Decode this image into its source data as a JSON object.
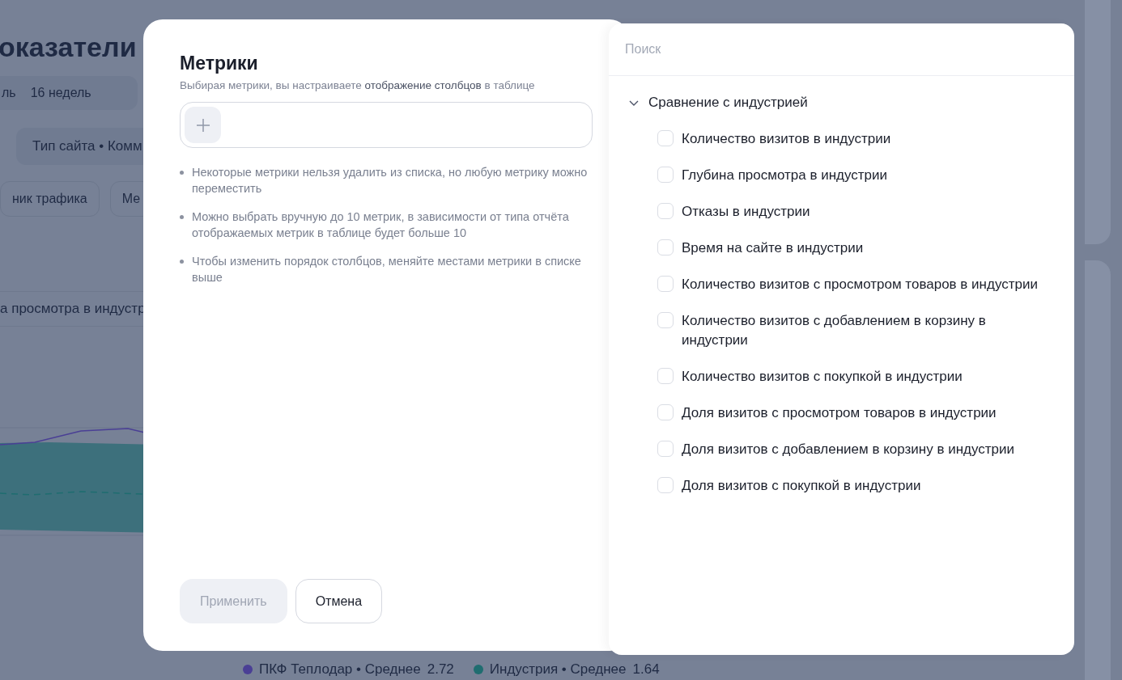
{
  "background": {
    "title": "оказатели",
    "periods": [
      {
        "label": "ль",
        "selected": false
      },
      {
        "label": "16 недель",
        "selected": false
      }
    ],
    "filters": [
      "Тип сайта • Комм"
    ],
    "filter_buttons": [
      "ник трафика",
      "Ме"
    ],
    "metric_select": "а просмотра в индустр",
    "legend": [
      {
        "label": "ПКФ Теплодар • Среднее",
        "value": "2.72",
        "color": "#4a3f95"
      },
      {
        "label": "Индустрия • Среднее",
        "value": "1.64",
        "color": "#1f6d70"
      }
    ]
  },
  "modal": {
    "title": "Метрики",
    "subtitle": "Выбирая метрики, вы настраиваете **отображение столбцов** в таблице",
    "notes": [
      "Некоторые метрики нельзя удалить из списка, но любую метрику можно переместить",
      "Можно выбрать вручную до 10 метрик, в зависимости от типа отчёта отображаемых метрик в таблице будет больше 10",
      "Чтобы изменить порядок столбцов, меняйте местами метрики в списке выше"
    ],
    "buttons": [
      {
        "label": "Применить",
        "disabled": true
      },
      {
        "label": "Отмена",
        "disabled": false
      }
    ]
  },
  "picker": {
    "search": {
      "placeholder": "Поиск"
    },
    "groups": [
      {
        "label": "Сравнение с индустрией",
        "expanded": true,
        "children": [
          {
            "label": "Количество визитов в индустрии",
            "checked": false
          },
          {
            "label": "Глубина просмотра в индустрии",
            "checked": false
          },
          {
            "label": "Отказы в индустрии",
            "checked": false
          },
          {
            "label": "Время на сайте в индустрии",
            "checked": false
          },
          {
            "label": "Количество визитов с просмотром товаров в индустрии",
            "checked": false
          },
          {
            "label": "Количество визитов с добавлением в корзину в индустрии",
            "checked": false
          },
          {
            "label": "Количество визитов с покупкой в индустрии",
            "checked": false
          },
          {
            "label": "Доля визитов с просмотром товаров в индустрии",
            "checked": false
          },
          {
            "label": "Доля визитов с добавлением в корзину в индустрии",
            "checked": false
          },
          {
            "label": "Доля визитов с покупкой в индустрии",
            "checked": false
          }
        ]
      }
    ]
  }
}
